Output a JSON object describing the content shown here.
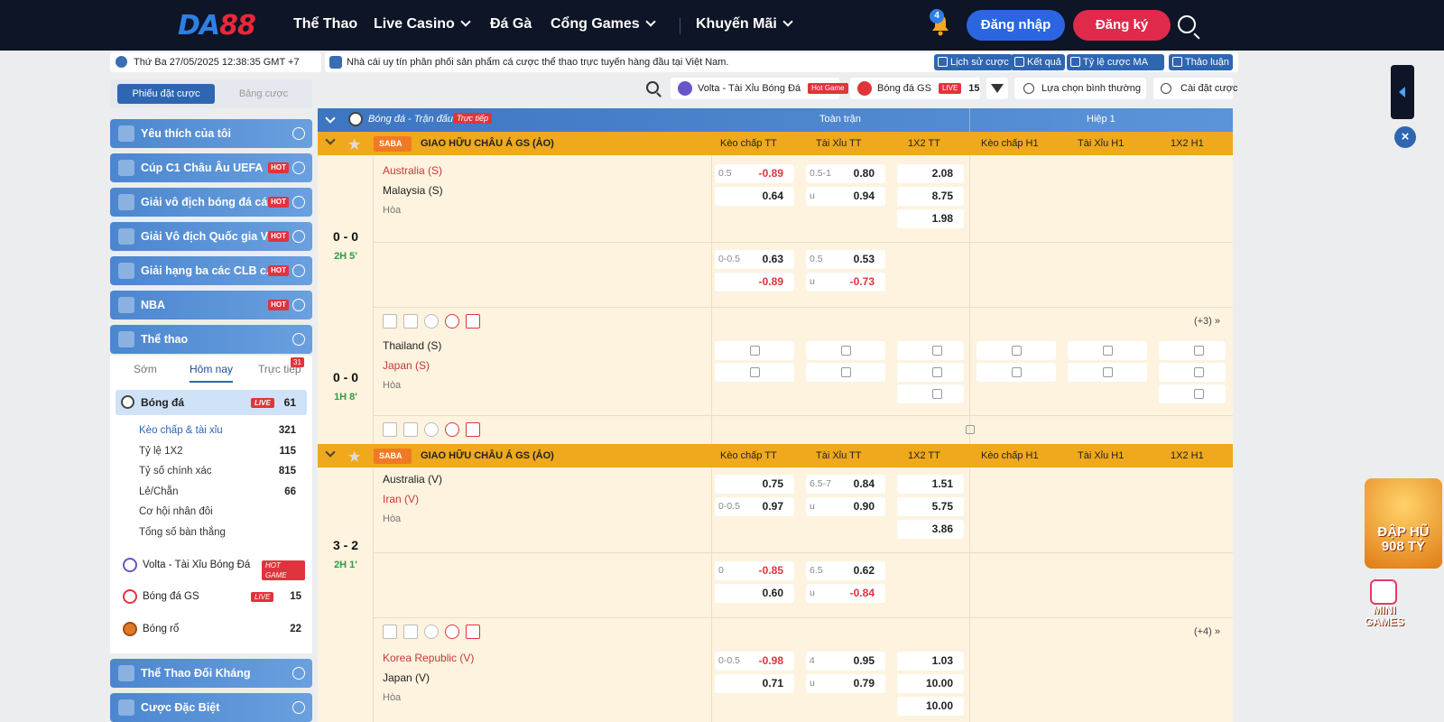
{
  "brand": {
    "part1": "DA",
    "part2": "88"
  },
  "nav": {
    "items": [
      "Thể Thao",
      "Live Casino",
      "Đá Gà",
      "Cổng Games",
      "Khuyến Mãi"
    ],
    "bell_count": "4",
    "login": "Đăng nhập",
    "register": "Đăng ký"
  },
  "info": {
    "datetime": "Thứ Ba 27/05/2025 12:38:35 GMT +7",
    "marquee": "Nhà cái uy tín phân phối sản phẩm cá cược thể thao trực tuyến hàng đầu tại Việt Nam.",
    "buttons": [
      "Lịch sử cược",
      "Kết quả",
      "Tỷ lệ cược MA",
      "Thảo luận"
    ]
  },
  "sidebar": {
    "tabs": [
      "Phiếu đặt cược",
      "Bảng cược"
    ],
    "categories": [
      {
        "label": "Yêu thích của tôi",
        "hot": ""
      },
      {
        "label": "Cúp C1 Châu Âu UEFA",
        "hot": "HOT"
      },
      {
        "label": "Giải vô địch bóng đá cá...",
        "hot": "HOT"
      },
      {
        "label": "Giải Vô địch Quốc gia V...",
        "hot": "HOT"
      },
      {
        "label": "Giải hạng ba các CLB c...",
        "hot": "HOT"
      },
      {
        "label": "NBA",
        "hot": "HOT"
      },
      {
        "label": "Thể thao",
        "hot": ""
      }
    ],
    "period_tabs": [
      "Sớm",
      "Hôm nay",
      "Trực tiếp"
    ],
    "live_count": "31",
    "football": {
      "label": "Bóng đá",
      "badge": "LIVE",
      "count": "61"
    },
    "bet_types": [
      {
        "label": "Kèo chấp & tài xỉu",
        "count": "321"
      },
      {
        "label": "Tỷ lệ 1X2",
        "count": "115"
      },
      {
        "label": "Tỷ số chính xác",
        "count": "815"
      },
      {
        "label": "Lẻ/Chẵn",
        "count": "66"
      },
      {
        "label": "Cơ hội nhân đôi",
        "count": ""
      },
      {
        "label": "Tổng số bàn thắng",
        "count": ""
      }
    ],
    "sports": [
      {
        "label": "Volta - Tài Xỉu Bóng Đá",
        "badge": "HOT GAME",
        "count": ""
      },
      {
        "label": "Bóng đá GS",
        "badge": "LIVE",
        "count": "15"
      },
      {
        "label": "Bóng rổ",
        "badge": "",
        "count": "22"
      }
    ],
    "bottom": [
      "Thể Thao Đối Kháng",
      "Cược Đặc Biệt"
    ]
  },
  "toolbar": {
    "chip1": "Volta - Tài Xỉu Bóng Đá",
    "chip1_badge": "Hot Game",
    "chip2": "Bóng đá GS",
    "chip2_badge": "LIVE",
    "chip2_count": "15",
    "sort": "Lựa chọn bình thường",
    "settings": "Cài đặt cược"
  },
  "table": {
    "header": {
      "title": "Bóng đá - Trận đấu",
      "live": "Trực tiếp",
      "full": "Toàn trận",
      "half": "Hiệp 1"
    },
    "cols": [
      "Kèo chấp TT",
      "Tài Xỉu TT",
      "1X2 TT",
      "Kèo chấp H1",
      "Tài Xỉu H1",
      "1X2 H1"
    ],
    "league": "GIAO HỮU CHÂU Á GS (ẢO)",
    "league_logo": "SABA",
    "draw": "Hòa",
    "matches": [
      {
        "home": "Australia (S)",
        "away": "Malaysia (S)",
        "score": "0 - 0",
        "time": "2H 5'",
        "more": "(+3)",
        "r1": {
          "hc": [
            [
              "0.5",
              "-0.89"
            ],
            [
              "",
              "0.64"
            ]
          ],
          "ou": [
            [
              "0.5-1",
              "0.80"
            ],
            [
              "u",
              "0.94"
            ]
          ],
          "x": [
            "2.08",
            "8.75",
            "1.98"
          ]
        },
        "r2": {
          "hc": [
            [
              "0-0.5",
              "0.63"
            ],
            [
              "",
              "-0.89"
            ]
          ],
          "ou": [
            [
              "0.5",
              "0.53"
            ],
            [
              "u",
              "-0.73"
            ]
          ]
        }
      },
      {
        "home": "Thailand (S)",
        "away": "Japan (S)",
        "score": "0 - 0",
        "time": "1H 8'"
      },
      {
        "home": "Australia (V)",
        "away": "Iran (V)",
        "score": "3 - 2",
        "time": "2H 1'",
        "more": "(+4)",
        "r1": {
          "hc": [
            [
              "",
              "0.75"
            ],
            [
              "0-0.5",
              "0.97"
            ]
          ],
          "ou": [
            [
              "6.5-7",
              "0.84"
            ],
            [
              "u",
              "0.90"
            ]
          ],
          "x": [
            "1.51",
            "5.75",
            "3.86"
          ]
        },
        "r2": {
          "hc": [
            [
              "0",
              "-0.85"
            ],
            [
              "",
              "0.60"
            ]
          ],
          "ou": [
            [
              "6.5",
              "0.62"
            ],
            [
              "u",
              "-0.84"
            ]
          ]
        }
      },
      {
        "home": "Korea Republic (V)",
        "away": "Japan (V)",
        "r1": {
          "hc": [
            [
              "0-0.5",
              "-0.98"
            ],
            [
              "",
              "0.71"
            ]
          ],
          "ou": [
            [
              "4",
              "0.95"
            ],
            [
              "u",
              "0.79"
            ]
          ],
          "x": [
            "1.03",
            "10.00",
            "10.00"
          ]
        }
      }
    ]
  },
  "promo": {
    "text": "ĐẬP HŨ 908 TỶ",
    "mini": "MINI GAMES"
  }
}
